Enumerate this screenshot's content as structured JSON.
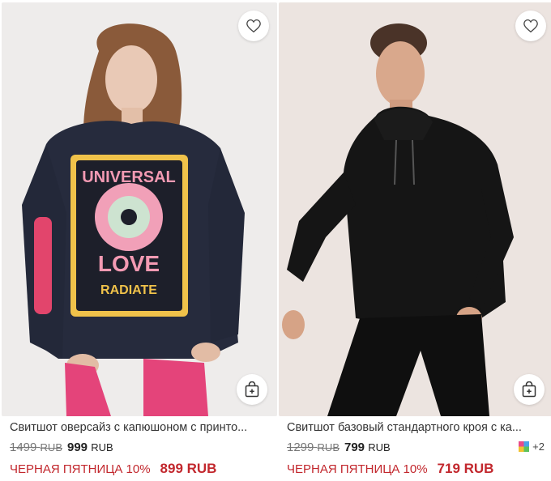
{
  "products": [
    {
      "title": "Свитшот оверсайз с капюшоном с принто...",
      "old_price_value": "1499",
      "old_price_currency": "RUB",
      "price_value": "999",
      "price_currency": "RUB",
      "promo_label": "ЧЕРНАЯ ПЯТНИЦА 10%",
      "promo_price": "899 RUB",
      "print_text": [
        "UNIVERSAL",
        "LOVE",
        "RADIATE"
      ]
    },
    {
      "title": "Свитшот базовый стандартного кроя с ка...",
      "old_price_value": "1299",
      "old_price_currency": "RUB",
      "price_value": "799",
      "price_currency": "RUB",
      "promo_label": "ЧЕРНАЯ ПЯТНИЦА 10%",
      "promo_price": "719 RUB",
      "more_colors": "+2"
    }
  ],
  "colors": {
    "promo": "#c2272d",
    "fav_icon": "heart-icon",
    "cart_icon": "add-to-bag-icon"
  }
}
